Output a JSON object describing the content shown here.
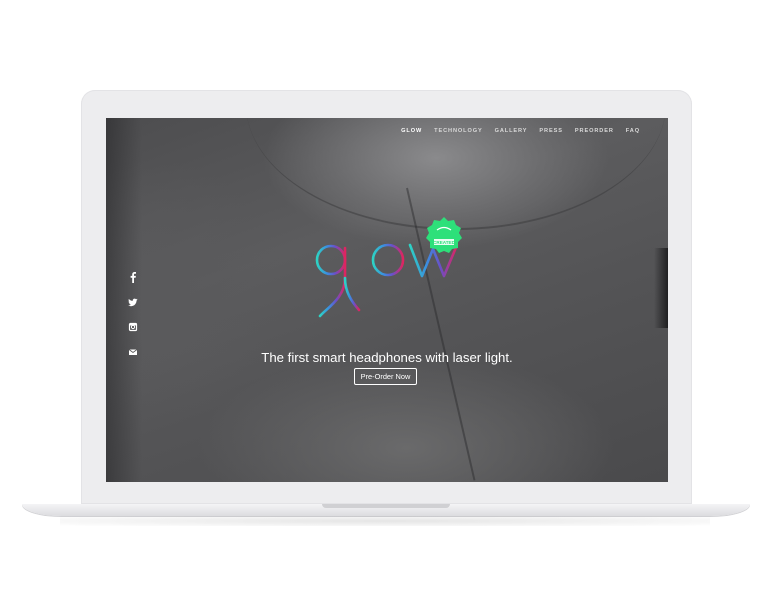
{
  "nav": {
    "items": [
      "GLOW",
      "TECHNOLOGY",
      "GALLERY",
      "PRESS",
      "PREORDER",
      "FAQ"
    ]
  },
  "social": {
    "icons": [
      "facebook-icon",
      "twitter-icon",
      "instagram-icon",
      "mail-icon"
    ]
  },
  "logo": {
    "text": "glow",
    "badge_text": "CREATED"
  },
  "hero": {
    "tagline": "The first smart headphones with laser light.",
    "cta_label": "Pre-Order Now"
  },
  "colors": {
    "logo_start": "#2dd3c4",
    "logo_mid": "#6a4fc9",
    "logo_end": "#e0245e",
    "badge": "#2de07a"
  }
}
